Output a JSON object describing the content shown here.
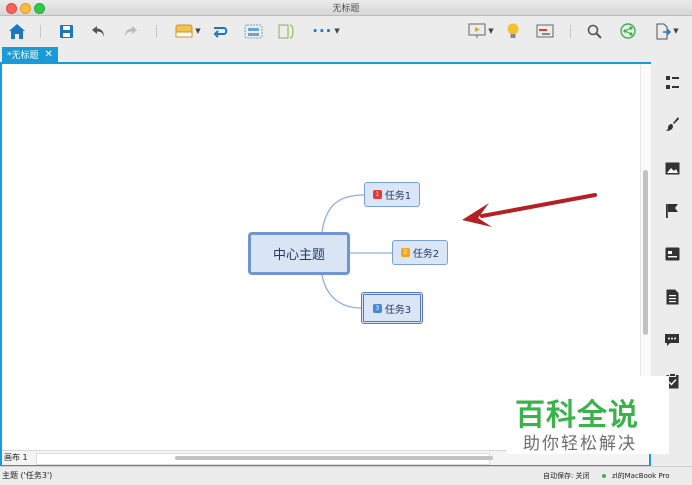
{
  "window": {
    "title": "无标题"
  },
  "tabs": [
    {
      "label": "*无标题",
      "close": "✕"
    }
  ],
  "mindmap": {
    "central": "中心主题",
    "topics": [
      {
        "label": "任务1",
        "marker": "1",
        "marker_color": "#e03b3b"
      },
      {
        "label": "任务2",
        "marker": "2",
        "marker_color": "#f2a61c"
      },
      {
        "label": "任务3",
        "marker": "3",
        "marker_color": "#4a86d4"
      }
    ]
  },
  "sheet": {
    "label": "画布 1"
  },
  "status": {
    "selection": "主题 ('任务3')",
    "autosave": "自动保存: 关闭",
    "user": "zl的MacBook Pro"
  },
  "watermark": {
    "main": "百科全说",
    "sub": "助你轻松解决"
  },
  "colors": {
    "accent": "#1a9bd7",
    "arrow": "#b52025"
  }
}
